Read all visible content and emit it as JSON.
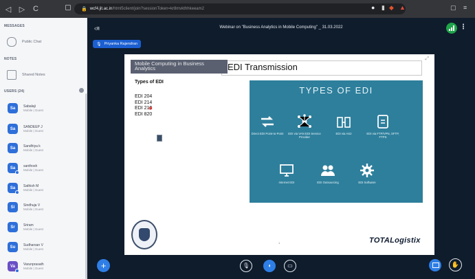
{
  "browser": {
    "nav_back": "◁",
    "nav_forward": "▷",
    "nav_reload": "C",
    "url_host": "wcf4.jit.ac.in",
    "url_path": "/html5client/join?sessionToken=kr8mvkthhkeeam2"
  },
  "sidebar": {
    "messages_title": "MESSAGES",
    "public_chat": "Public Chat",
    "notes_title": "NOTES",
    "shared_notes": "Shared Notes",
    "users_title": "USERS (24)",
    "users": [
      {
        "initials": "Sa",
        "name": "Sabalaji",
        "role": "Mobile | Guest"
      },
      {
        "initials": "Sa",
        "name": "SANDEEP J",
        "role": "Mobile | Guest"
      },
      {
        "initials": "Sa",
        "name": "Sandhiya k",
        "role": "Mobile | Guest"
      },
      {
        "initials": "Sa",
        "name": "santhosh",
        "role": "Mobile | Guest"
      },
      {
        "initials": "Sa",
        "name": "Sathish M",
        "role": "Mobile | Guest"
      },
      {
        "initials": "Si",
        "name": "Sindhuja V",
        "role": "Mobile | Guest"
      },
      {
        "initials": "Sr",
        "name": "Sriram",
        "role": "Mobile | Guest"
      },
      {
        "initials": "Su",
        "name": "Sudharsan V",
        "role": "Mobile | Guest"
      },
      {
        "initials": "Va",
        "name": "Varunprasath",
        "role": "Mobile | Guest"
      }
    ]
  },
  "header": {
    "title": "Webinar on \"Business Analytics in Mobile Computing\" _ 31.03.2022",
    "presenter": "Priyanka Rajendran"
  },
  "slide": {
    "course": "Mobile Computing in Business Analytics",
    "title": "EDI Transmission",
    "types_heading": "Types of EDI",
    "edi_list": [
      "EDI 204",
      "EDI 214",
      "EDI 210",
      "EDI 820"
    ],
    "infographic_title": "TYPES OF EDI",
    "infographic_items": [
      {
        "label": "Direct EDI Point-to-Point",
        "icon": "arrows-icon"
      },
      {
        "label": "EDI via VAN EDI Service Provider",
        "icon": "network-icon"
      },
      {
        "label": "EDI via AS2",
        "icon": "servers-icon"
      },
      {
        "label": "EDI via FTP/VPN, SFTP, FTPS",
        "icon": "document-icon"
      },
      {
        "label": "Internet EDI",
        "icon": "monitor-icon"
      },
      {
        "label": "EDI Outsourcing",
        "icon": "people-icon"
      },
      {
        "label": "EDI Software",
        "icon": "gear-icon"
      }
    ],
    "brand": "TOTALogistix",
    "page_number": "1"
  },
  "colors": {
    "accent": "#2e7ee6",
    "background": "#0f1c2c",
    "infographic": "#2e7f9c",
    "presenter_badge": "#1b5fd1"
  }
}
